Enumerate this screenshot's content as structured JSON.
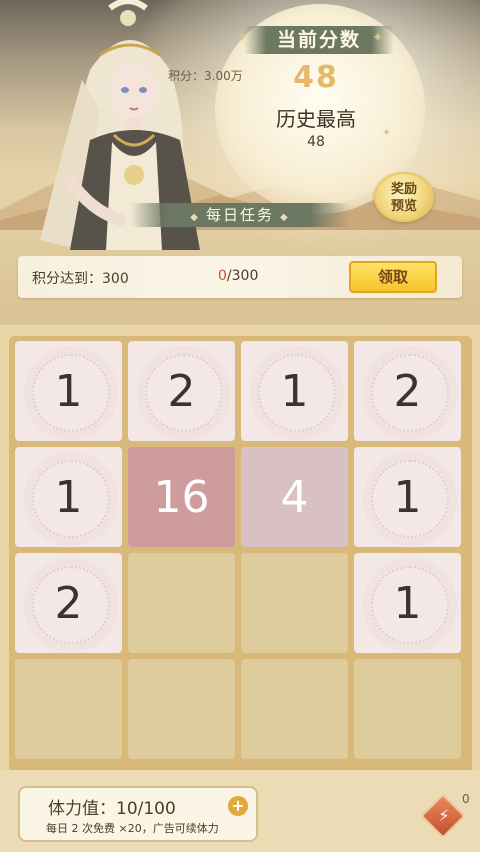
{
  "header": {
    "current_score_label": "当前分数",
    "current_score": "48",
    "points_note": "积分：3.00万",
    "best_label": "历史最高",
    "best_value": "48",
    "reward_line1": "奖励",
    "reward_line2": "预览",
    "daily_task_title": "每日任务"
  },
  "task": {
    "label": "积分达到：300",
    "progress_current": "0",
    "progress_total": "/300",
    "claim_label": "领取"
  },
  "board": {
    "cells": [
      {
        "value": "1",
        "tile": "t1"
      },
      {
        "value": "2",
        "tile": "t2"
      },
      {
        "value": "1",
        "tile": "t1"
      },
      {
        "value": "2",
        "tile": "t2"
      },
      {
        "value": "1",
        "tile": "t1"
      },
      {
        "value": "16",
        "tile": "t16"
      },
      {
        "value": "4",
        "tile": "t4"
      },
      {
        "value": "1",
        "tile": "t1"
      },
      {
        "value": "2",
        "tile": "t2"
      },
      {
        "value": "",
        "tile": "empty"
      },
      {
        "value": "",
        "tile": "empty"
      },
      {
        "value": "1",
        "tile": "t1"
      },
      {
        "value": "",
        "tile": "empty"
      },
      {
        "value": "",
        "tile": "empty"
      },
      {
        "value": "",
        "tile": "empty"
      },
      {
        "value": "",
        "tile": "empty"
      }
    ]
  },
  "footer": {
    "stamina_label": "体力值：10/100",
    "stamina_note": "每日 2 次免费 ×20，广告可续体力",
    "plus_icon": "plus-icon",
    "diamond_icon": "lightning-diamond-icon",
    "diamond_count": "0"
  },
  "colors": {
    "tile_small": "#f4e8e6",
    "tile_4": "#d8c0c3",
    "tile_16": "#cf9c9e",
    "empty": "#dfcc9c",
    "claim": "#f6c52a",
    "score": "#e6b86a"
  }
}
